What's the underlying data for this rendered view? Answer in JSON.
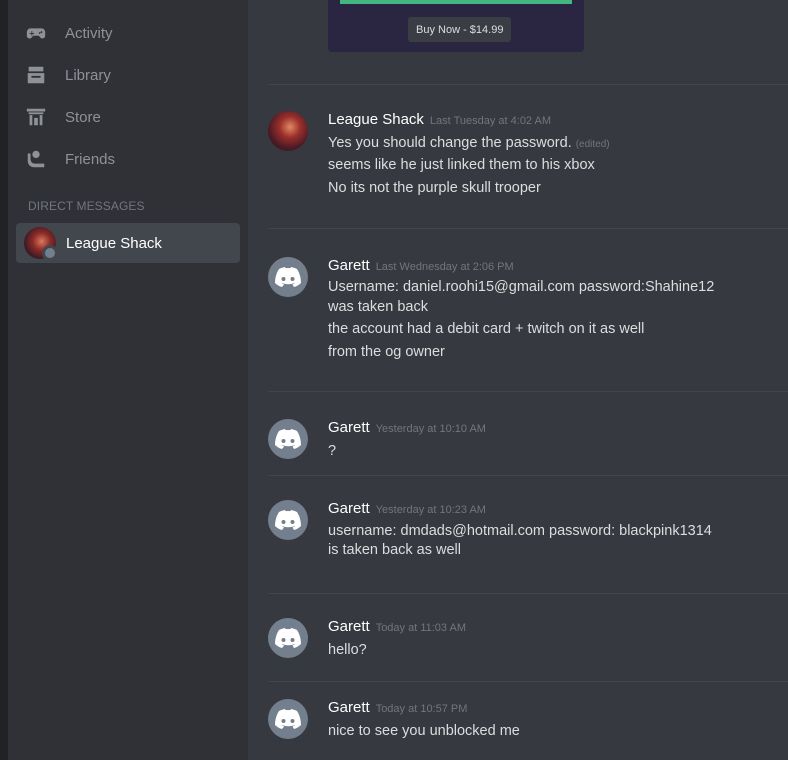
{
  "sidebar": {
    "nav": [
      {
        "label": "Activity",
        "icon": "gamepad-icon"
      },
      {
        "label": "Library",
        "icon": "library-icon"
      },
      {
        "label": "Store",
        "icon": "store-icon"
      },
      {
        "label": "Friends",
        "icon": "friends-icon"
      }
    ],
    "dm_header": "DIRECT MESSAGES",
    "dm": {
      "name": "League Shack"
    }
  },
  "embed": {
    "buy_label": "Buy Now - $14.99"
  },
  "messages": [
    {
      "author": "League Shack",
      "timestamp": "Last Tuesday at 4:02 AM",
      "lines": [
        "Yes you should change the password.",
        "seems like he just linked them to his xbox",
        "No its not the purple skull trooper"
      ],
      "edited_label": "(edited)"
    },
    {
      "author": "Garett",
      "timestamp": "Last Wednesday at 2:06 PM",
      "lines": [
        "Username: daniel.roohi15@gmail.com password:Shahine12",
        "was taken back",
        "the account had a debit card + twitch on it as well",
        "from the og owner"
      ]
    },
    {
      "author": "Garett",
      "timestamp": "Yesterday at 10:10 AM",
      "lines": [
        "?"
      ]
    },
    {
      "author": "Garett",
      "timestamp": "Yesterday at 10:23 AM",
      "lines": [
        "username: dmdads@hotmail.com password: blackpink1314",
        "is taken back as well"
      ]
    },
    {
      "author": "Garett",
      "timestamp": "Today at 11:03 AM",
      "lines": [
        "hello?"
      ]
    },
    {
      "author": "Garett",
      "timestamp": "Today at 10:57 PM",
      "lines": [
        "nice to see you unblocked me"
      ]
    }
  ]
}
